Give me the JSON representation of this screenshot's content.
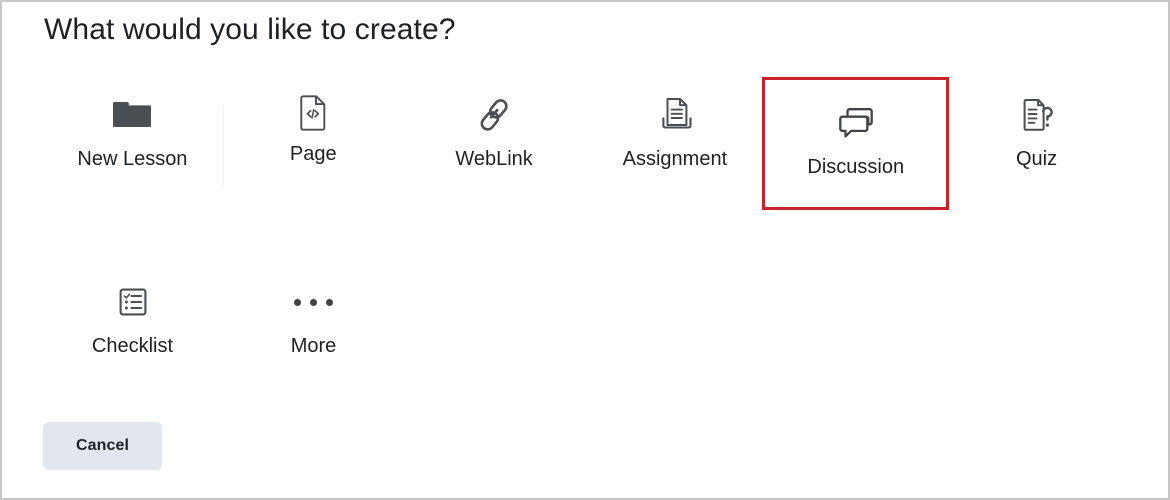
{
  "dialog": {
    "title": "What would you like to create?",
    "cancel_label": "Cancel"
  },
  "colors": {
    "highlight_border": "#cc2127",
    "icon": "#4a4f54",
    "text": "#1d2125",
    "cancel_background": "#e2e7ef",
    "window_border": "#c7c7c7",
    "divider": "#f1efef"
  },
  "options": [
    {
      "label": "New Lesson",
      "icon": "folder-icon",
      "highlighted": false
    },
    {
      "label": "Page",
      "icon": "code-page-icon",
      "highlighted": false
    },
    {
      "label": "WebLink",
      "icon": "chain-link-icon",
      "highlighted": false
    },
    {
      "label": "Assignment",
      "icon": "assignment-icon",
      "highlighted": false
    },
    {
      "label": "Discussion",
      "icon": "speech-bubbles-icon",
      "highlighted": true
    },
    {
      "label": "Quiz",
      "icon": "quiz-question-icon",
      "highlighted": false
    },
    {
      "label": "Checklist",
      "icon": "checklist-icon",
      "highlighted": false
    },
    {
      "label": "More",
      "icon": "ellipsis-icon",
      "highlighted": false
    }
  ]
}
